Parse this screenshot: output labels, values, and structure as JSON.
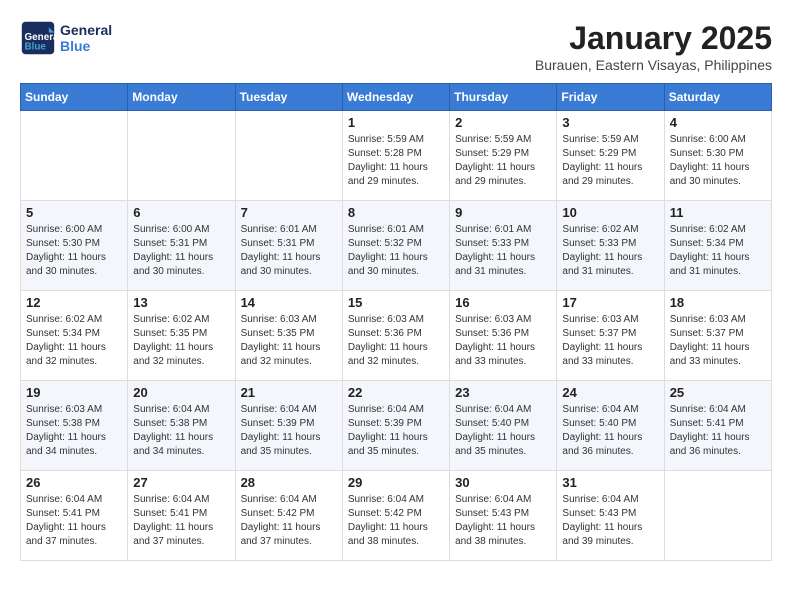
{
  "logo": {
    "line1": "General",
    "line2": "Blue"
  },
  "title": "January 2025",
  "subtitle": "Burauen, Eastern Visayas, Philippines",
  "header_days": [
    "Sunday",
    "Monday",
    "Tuesday",
    "Wednesday",
    "Thursday",
    "Friday",
    "Saturday"
  ],
  "weeks": [
    [
      {
        "day": "",
        "text": ""
      },
      {
        "day": "",
        "text": ""
      },
      {
        "day": "",
        "text": ""
      },
      {
        "day": "1",
        "text": "Sunrise: 5:59 AM\nSunset: 5:28 PM\nDaylight: 11 hours and 29 minutes."
      },
      {
        "day": "2",
        "text": "Sunrise: 5:59 AM\nSunset: 5:29 PM\nDaylight: 11 hours and 29 minutes."
      },
      {
        "day": "3",
        "text": "Sunrise: 5:59 AM\nSunset: 5:29 PM\nDaylight: 11 hours and 29 minutes."
      },
      {
        "day": "4",
        "text": "Sunrise: 6:00 AM\nSunset: 5:30 PM\nDaylight: 11 hours and 30 minutes."
      }
    ],
    [
      {
        "day": "5",
        "text": "Sunrise: 6:00 AM\nSunset: 5:30 PM\nDaylight: 11 hours and 30 minutes."
      },
      {
        "day": "6",
        "text": "Sunrise: 6:00 AM\nSunset: 5:31 PM\nDaylight: 11 hours and 30 minutes."
      },
      {
        "day": "7",
        "text": "Sunrise: 6:01 AM\nSunset: 5:31 PM\nDaylight: 11 hours and 30 minutes."
      },
      {
        "day": "8",
        "text": "Sunrise: 6:01 AM\nSunset: 5:32 PM\nDaylight: 11 hours and 30 minutes."
      },
      {
        "day": "9",
        "text": "Sunrise: 6:01 AM\nSunset: 5:33 PM\nDaylight: 11 hours and 31 minutes."
      },
      {
        "day": "10",
        "text": "Sunrise: 6:02 AM\nSunset: 5:33 PM\nDaylight: 11 hours and 31 minutes."
      },
      {
        "day": "11",
        "text": "Sunrise: 6:02 AM\nSunset: 5:34 PM\nDaylight: 11 hours and 31 minutes."
      }
    ],
    [
      {
        "day": "12",
        "text": "Sunrise: 6:02 AM\nSunset: 5:34 PM\nDaylight: 11 hours and 32 minutes."
      },
      {
        "day": "13",
        "text": "Sunrise: 6:02 AM\nSunset: 5:35 PM\nDaylight: 11 hours and 32 minutes."
      },
      {
        "day": "14",
        "text": "Sunrise: 6:03 AM\nSunset: 5:35 PM\nDaylight: 11 hours and 32 minutes."
      },
      {
        "day": "15",
        "text": "Sunrise: 6:03 AM\nSunset: 5:36 PM\nDaylight: 11 hours and 32 minutes."
      },
      {
        "day": "16",
        "text": "Sunrise: 6:03 AM\nSunset: 5:36 PM\nDaylight: 11 hours and 33 minutes."
      },
      {
        "day": "17",
        "text": "Sunrise: 6:03 AM\nSunset: 5:37 PM\nDaylight: 11 hours and 33 minutes."
      },
      {
        "day": "18",
        "text": "Sunrise: 6:03 AM\nSunset: 5:37 PM\nDaylight: 11 hours and 33 minutes."
      }
    ],
    [
      {
        "day": "19",
        "text": "Sunrise: 6:03 AM\nSunset: 5:38 PM\nDaylight: 11 hours and 34 minutes."
      },
      {
        "day": "20",
        "text": "Sunrise: 6:04 AM\nSunset: 5:38 PM\nDaylight: 11 hours and 34 minutes."
      },
      {
        "day": "21",
        "text": "Sunrise: 6:04 AM\nSunset: 5:39 PM\nDaylight: 11 hours and 35 minutes."
      },
      {
        "day": "22",
        "text": "Sunrise: 6:04 AM\nSunset: 5:39 PM\nDaylight: 11 hours and 35 minutes."
      },
      {
        "day": "23",
        "text": "Sunrise: 6:04 AM\nSunset: 5:40 PM\nDaylight: 11 hours and 35 minutes."
      },
      {
        "day": "24",
        "text": "Sunrise: 6:04 AM\nSunset: 5:40 PM\nDaylight: 11 hours and 36 minutes."
      },
      {
        "day": "25",
        "text": "Sunrise: 6:04 AM\nSunset: 5:41 PM\nDaylight: 11 hours and 36 minutes."
      }
    ],
    [
      {
        "day": "26",
        "text": "Sunrise: 6:04 AM\nSunset: 5:41 PM\nDaylight: 11 hours and 37 minutes."
      },
      {
        "day": "27",
        "text": "Sunrise: 6:04 AM\nSunset: 5:41 PM\nDaylight: 11 hours and 37 minutes."
      },
      {
        "day": "28",
        "text": "Sunrise: 6:04 AM\nSunset: 5:42 PM\nDaylight: 11 hours and 37 minutes."
      },
      {
        "day": "29",
        "text": "Sunrise: 6:04 AM\nSunset: 5:42 PM\nDaylight: 11 hours and 38 minutes."
      },
      {
        "day": "30",
        "text": "Sunrise: 6:04 AM\nSunset: 5:43 PM\nDaylight: 11 hours and 38 minutes."
      },
      {
        "day": "31",
        "text": "Sunrise: 6:04 AM\nSunset: 5:43 PM\nDaylight: 11 hours and 39 minutes."
      },
      {
        "day": "",
        "text": ""
      }
    ]
  ]
}
